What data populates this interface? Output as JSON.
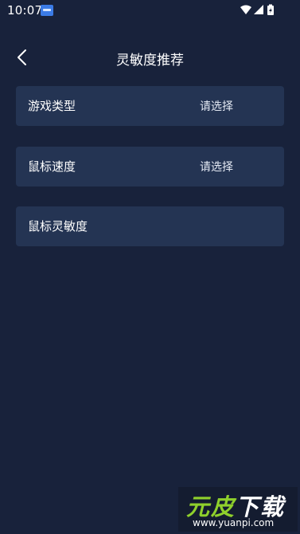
{
  "status_bar": {
    "time": "10:07",
    "app_icon": "notification-app-icon",
    "icons": [
      "wifi-icon",
      "signal-icon",
      "battery-charging-icon"
    ]
  },
  "header": {
    "back_icon": "chevron-left-icon",
    "title": "灵敏度推荐"
  },
  "settings": {
    "rows": [
      {
        "label": "游戏类型",
        "value": "请选择"
      },
      {
        "label": "鼠标速度",
        "value": "请选择"
      },
      {
        "label": "鼠标灵敏度",
        "value": ""
      }
    ]
  },
  "watermark": {
    "logo_text_a": "元皮",
    "logo_text_b": "下载",
    "url": "www.yuanpi.com"
  },
  "colors": {
    "background": "#18223b",
    "row_background": "#243453",
    "text": "#ffffff",
    "watermark_green": "#8fd02c"
  }
}
